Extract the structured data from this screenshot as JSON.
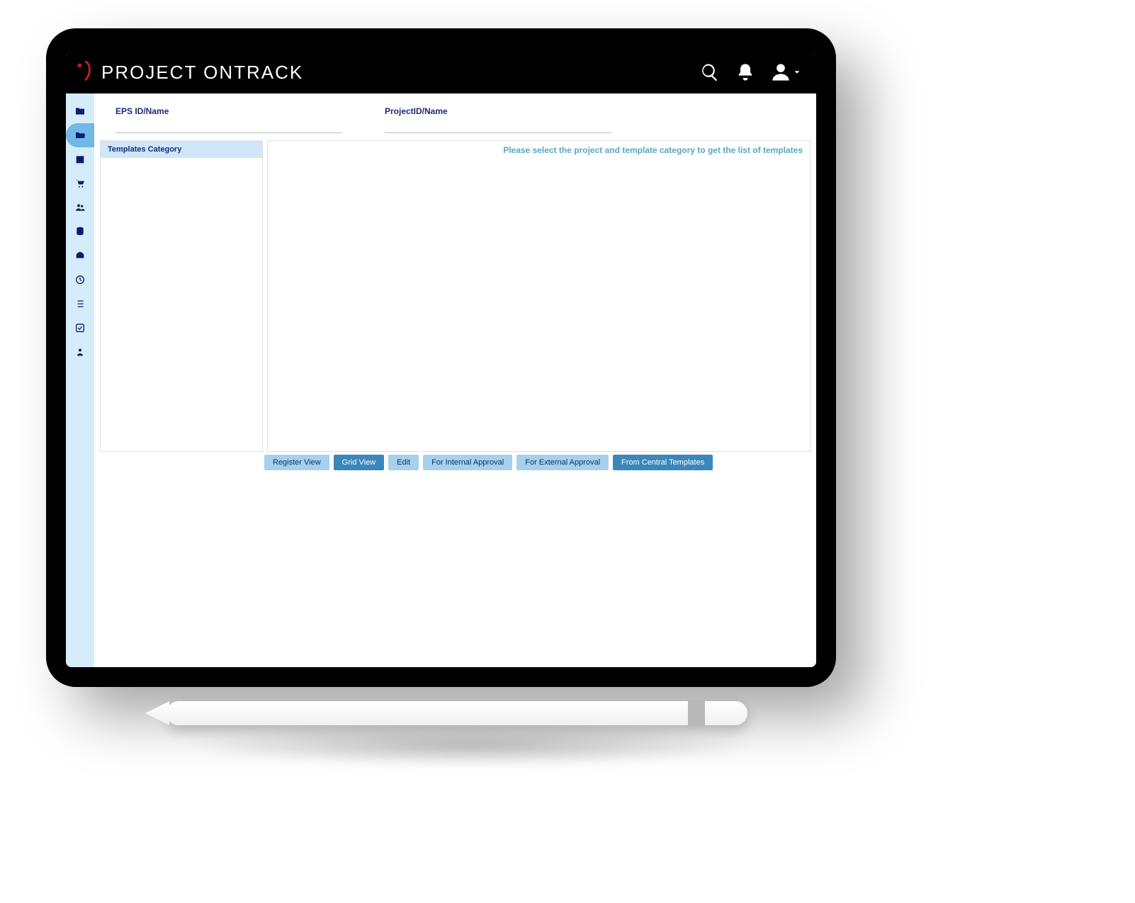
{
  "header": {
    "brand_prefix": "P",
    "brand_rest": "ROJECT ONTRACK"
  },
  "filters": {
    "eps_label": "EPS ID/Name",
    "eps_value": "",
    "project_label": "ProjectID/Name",
    "project_value": ""
  },
  "left_panel": {
    "header": "Templates Category"
  },
  "right_panel": {
    "helper": "Please select the project and template category to get the list of templates"
  },
  "buttons": {
    "register_view": "Register View",
    "grid_view": "Grid View",
    "edit": "Edit",
    "internal_approval": "For Internal Approval",
    "external_approval": "For External Approval",
    "from_central": "From Central Templates"
  },
  "sidebar": {
    "items": [
      {
        "name": "folder"
      },
      {
        "name": "open-folder",
        "active": true
      },
      {
        "name": "calendar"
      },
      {
        "name": "cart"
      },
      {
        "name": "users"
      },
      {
        "name": "database"
      },
      {
        "name": "finance"
      },
      {
        "name": "clock"
      },
      {
        "name": "list"
      },
      {
        "name": "check"
      },
      {
        "name": "person"
      }
    ]
  }
}
